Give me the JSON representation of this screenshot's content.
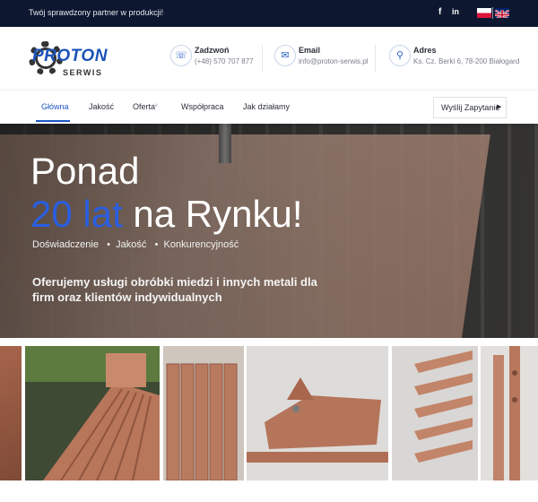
{
  "topbar": {
    "tagline": "Twój sprawdzony partner w produkcji!",
    "social": [
      {
        "icon": "facebook-icon",
        "glyph": "f"
      },
      {
        "icon": "linkedin-icon",
        "glyph": "in"
      }
    ],
    "languages": [
      "pl-flag-icon",
      "en-flag-icon"
    ]
  },
  "header": {
    "logo": {
      "brand": "PROTON",
      "sub": "SERWIS",
      "icon": "gear-logo-icon"
    },
    "contacts": [
      {
        "icon": "phone-icon",
        "label": "Zadzwoń",
        "value": "(+48) 570 707 877"
      },
      {
        "icon": "mail-icon",
        "label": "Email",
        "value": "info@proton-serwis.pl"
      },
      {
        "icon": "location-icon",
        "label": "Adres",
        "value": "Ks. Cz. Berki 6, 78-200 Białogard"
      }
    ]
  },
  "nav": {
    "items": [
      "Główna",
      "Jakość",
      "Oferta",
      "Współpraca",
      "Jak działamy"
    ],
    "active": "Główna",
    "cta": "Wyślij Zapytanie"
  },
  "hero": {
    "line1": "Ponad",
    "accent": "20 lat",
    "line2_rest": "na Rynku!",
    "keywords": [
      "Doświadczenie",
      "Jakość",
      "Konkurencyjność"
    ],
    "description": "Oferujemy usługi obróbki miedzi i innych metali dla firm oraz klientów indywidualnych"
  },
  "colors": {
    "accent": "#1d56c4",
    "topbar": "#0d1730",
    "copper": "#b87a5e"
  },
  "gallery": [
    "copper-parts-photo-1",
    "copper-busbar-photo-2",
    "copper-plates-photo-3",
    "copper-bracket-photo-4",
    "copper-strips-photo-5",
    "copper-bars-photo-6"
  ]
}
